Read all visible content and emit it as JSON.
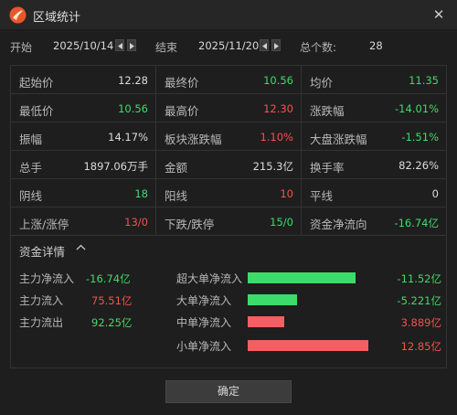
{
  "window": {
    "title": "区域统计"
  },
  "range": {
    "start_label": "开始",
    "start_date": "2025/10/14",
    "end_label": "结束",
    "end_date": "2025/11/20",
    "count_label": "总个数:",
    "count_value": "28"
  },
  "stats": [
    {
      "label": "起始价",
      "value": "12.28",
      "color": "white"
    },
    {
      "label": "最终价",
      "value": "10.56",
      "color": "green"
    },
    {
      "label": "均价",
      "value": "11.35",
      "color": "green"
    },
    {
      "label": "最低价",
      "value": "10.56",
      "color": "green"
    },
    {
      "label": "最高价",
      "value": "12.30",
      "color": "red"
    },
    {
      "label": "涨跌幅",
      "value": "-14.01%",
      "color": "green"
    },
    {
      "label": "振幅",
      "value": "14.17%",
      "color": "white"
    },
    {
      "label": "板块涨跌幅",
      "value": "1.10%",
      "color": "red"
    },
    {
      "label": "大盘涨跌幅",
      "value": "-1.51%",
      "color": "green"
    },
    {
      "label": "总手",
      "value": "1897.06万手",
      "color": "white"
    },
    {
      "label": "金额",
      "value": "215.3亿",
      "color": "white"
    },
    {
      "label": "换手率",
      "value": "82.26%",
      "color": "white"
    },
    {
      "label": "阴线",
      "value": "18",
      "color": "green"
    },
    {
      "label": "阳线",
      "value": "10",
      "color": "red"
    },
    {
      "label": "平线",
      "value": "0",
      "color": "white"
    },
    {
      "label": "上涨/涨停",
      "value": "13/0",
      "color": "red"
    },
    {
      "label": "下跌/跌停",
      "value": "15/0",
      "color": "green"
    },
    {
      "label": "资金净流向",
      "value": "-16.74亿",
      "color": "green"
    }
  ],
  "fund": {
    "title": "资金详情",
    "left": [
      {
        "label": "主力净流入",
        "value": "-16.74亿",
        "color": "green"
      },
      {
        "label": "主力流入",
        "value": "75.51亿",
        "color": "red"
      },
      {
        "label": "主力流出",
        "value": "92.25亿",
        "color": "green"
      }
    ],
    "right": [
      {
        "label": "超大单净流入",
        "value": "-11.52亿",
        "amount": -11.52,
        "color": "green"
      },
      {
        "label": "大单净流入",
        "value": "-5.221亿",
        "amount": -5.221,
        "color": "green"
      },
      {
        "label": "中单净流入",
        "value": "3.889亿",
        "amount": 3.889,
        "color": "red"
      },
      {
        "label": "小单净流入",
        "value": "12.85亿",
        "amount": 12.85,
        "color": "red"
      }
    ]
  },
  "colors": {
    "green": "#3ddc6a",
    "red": "#f5514f",
    "bar_green": "#3ddc6a",
    "bar_red": "#f26061"
  },
  "icons": {
    "app": "logo-icon",
    "close": "close-icon",
    "prev": "prev-arrow-icon",
    "next": "next-arrow-icon",
    "collapse": "chevron-up-icon"
  },
  "buttons": {
    "ok": "确定"
  }
}
